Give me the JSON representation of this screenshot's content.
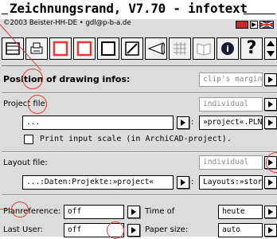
{
  "window": {
    "title": "Zeichnungsrand, V7.70 - infotext",
    "copyright": "©2003 Beister-HH-DE • gdl@p-b-a.de"
  },
  "toolbar": {
    "icons": [
      {
        "name": "drawing-area-icon",
        "glyph": "⊞"
      },
      {
        "name": "printer-icon",
        "glyph": "⎙"
      },
      {
        "name": "red-frame-icon",
        "glyph": "□"
      },
      {
        "name": "red-square-icon",
        "glyph": "▭"
      },
      {
        "name": "square-icon",
        "glyph": "□"
      },
      {
        "name": "slash-icon",
        "glyph": "◩"
      },
      {
        "name": "cone-icon",
        "glyph": "◁"
      },
      {
        "name": "grid-icon",
        "glyph": "▦"
      },
      {
        "name": "book-icon",
        "glyph": "📖"
      },
      {
        "name": "info-icon",
        "glyph": "ℹ"
      },
      {
        "name": "help-icon",
        "glyph": "?"
      }
    ]
  },
  "position": {
    "title": "Position of drawing infos:",
    "value": "clip's margin, "
  },
  "project": {
    "label": "Project file:",
    "mode": "individual",
    "path_value": "...",
    "template_value": "»project«.PLN",
    "print_scale_label": "Print input scale (in ArchiCAD-project)."
  },
  "layout": {
    "label": "Layout file:",
    "mode": "individual",
    "path_value": "...:Daten:Projekte:»project«",
    "template_value": "Layouts:»story"
  },
  "fields": {
    "planreference_label": "Planreference:",
    "planreference_value": "off",
    "time_label": "Time of",
    "time_value": "heute",
    "lastuser_label": "Last User:",
    "lastuser_value": "off",
    "papersize_label": "Paper size:",
    "papersize_value": "auto"
  },
  "colors": {
    "annotation_red": "#e53935",
    "flag_red": "#c62828",
    "flag_blue": "#1e3a8a"
  }
}
